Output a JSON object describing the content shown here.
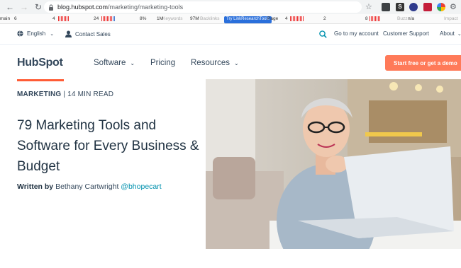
{
  "browser": {
    "url_host": "blog.hubspot.com",
    "url_path": "/marketing/marketing-tools"
  },
  "seo_toolbar": {
    "t1": "main",
    "t2": "6",
    "t3": "4",
    "t4": "24",
    "t5": "8%",
    "t6": "1M",
    "t7": "Keywords",
    "t8": "97M",
    "t9": "Backlinks",
    "try": "Try LinkResearchTools",
    "t10": "Page",
    "t11": "4",
    "t12": "2",
    "t13": "8",
    "t14": "Buzz",
    "t15": "n/a",
    "t16": "Impact"
  },
  "util_nav": {
    "language": "English",
    "contact": "Contact Sales",
    "account": "Go to my account",
    "support": "Customer Support",
    "about": "About"
  },
  "main_nav": {
    "logo": "HubSpot",
    "software": "Software",
    "pricing": "Pricing",
    "resources": "Resources",
    "cta": "Start free or get a demo"
  },
  "article": {
    "category": "MARKETING",
    "read_time": "| 14 MIN READ",
    "title": "79 Marketing Tools and Software for Every Business & Budget",
    "written_by": "Written by",
    "author": "Bethany Cartwright",
    "handle": "@bhopecart"
  },
  "colors": {
    "accent": "#ff5c35",
    "cta": "#ff7a59",
    "link": "#0091ae",
    "text": "#33475b"
  }
}
